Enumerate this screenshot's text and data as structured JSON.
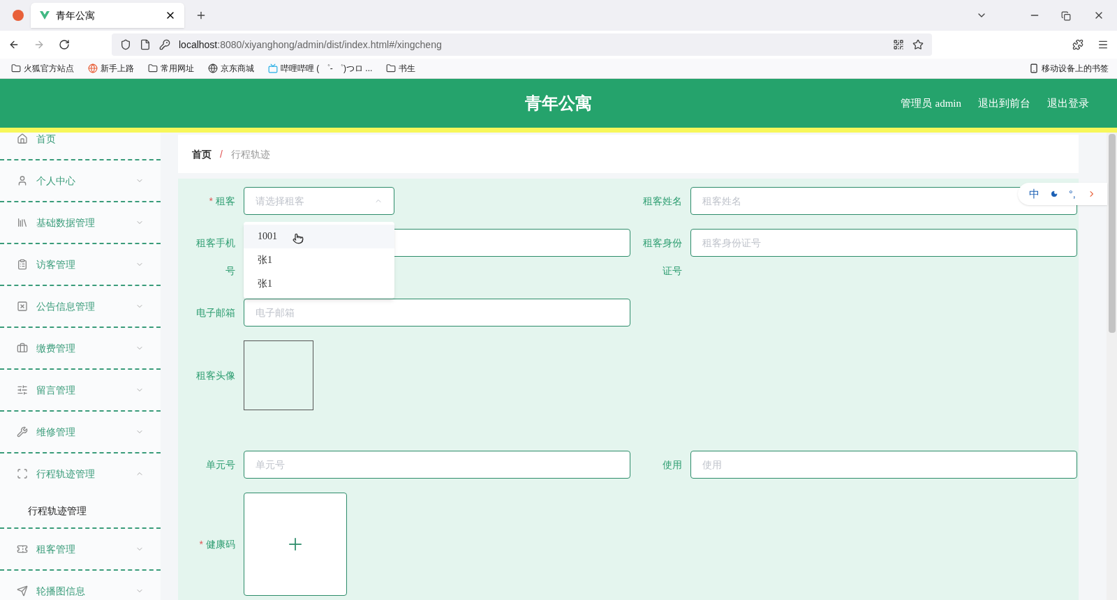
{
  "browser": {
    "tabs": [
      {
        "title": "青年公寓",
        "selected": true
      }
    ],
    "url_host": "localhost",
    "url_rest": ":8080/xiyanghong/admin/dist/index.html#/xingcheng",
    "bookmarks": [
      {
        "label": "火狐官方站点",
        "kind": "folder"
      },
      {
        "label": "新手上路",
        "kind": "firefox"
      },
      {
        "label": "常用网址",
        "kind": "folder"
      },
      {
        "label": "京东商城",
        "kind": "globe"
      },
      {
        "label": "哔哩哔哩 ( ゜- ゜)つロ ...",
        "kind": "tv"
      },
      {
        "label": "书生",
        "kind": "folder"
      }
    ],
    "mobile_bookmarks": "移动设备上的书签"
  },
  "header": {
    "title": "青年公寓",
    "role": "管理员",
    "user": "admin",
    "links": [
      "退出到前台",
      "退出登录"
    ]
  },
  "sidebar": {
    "items": [
      {
        "label": "首页",
        "kind": "home"
      },
      {
        "label": "个人中心",
        "kind": "user",
        "expanded": false
      },
      {
        "label": "基础数据管理",
        "kind": "books",
        "expanded": false
      },
      {
        "label": "访客管理",
        "kind": "clipboard",
        "expanded": false
      },
      {
        "label": "公告信息管理",
        "kind": "notice",
        "expanded": false
      },
      {
        "label": "缴费管理",
        "kind": "briefcase",
        "expanded": false
      },
      {
        "label": "留言管理",
        "kind": "sliders",
        "expanded": false
      },
      {
        "label": "维修管理",
        "kind": "tool",
        "expanded": false
      },
      {
        "label": "行程轨迹管理",
        "kind": "frame",
        "expanded": true,
        "children": [
          {
            "label": "行程轨迹管理"
          }
        ]
      },
      {
        "label": "租客管理",
        "kind": "ticket",
        "expanded": false
      },
      {
        "label": "轮播图信息",
        "kind": "send",
        "expanded": false
      }
    ]
  },
  "breadcrumb": {
    "items": [
      "首页",
      "行程轨迹"
    ],
    "separator": "/"
  },
  "form": {
    "required_mark": "*",
    "rows": [
      [
        {
          "kind": "select",
          "label": "租客",
          "required": true,
          "placeholder": "请选择租客",
          "open": true
        },
        {
          "kind": "input",
          "label": "租客姓名",
          "required": false,
          "placeholder": "租客姓名"
        }
      ],
      [
        {
          "kind": "input",
          "label": "租客手机号",
          "required": false
        },
        {
          "kind": "input",
          "label": "租客身份证号",
          "required": false,
          "placeholder": "租客身份证号"
        }
      ],
      [
        {
          "kind": "input",
          "label": "电子邮箱",
          "required": false,
          "placeholder": "电子邮箱"
        }
      ],
      [
        {
          "kind": "image",
          "label": "租客头像",
          "required": false
        }
      ],
      [
        {
          "kind": "input",
          "label": "单元号",
          "required": false,
          "placeholder": "单元号"
        },
        {
          "kind": "input",
          "label": "使用",
          "required": false,
          "placeholder": "使用"
        }
      ],
      [
        {
          "kind": "upload",
          "label": "健康码",
          "required": true
        }
      ]
    ],
    "dropdown": [
      {
        "label": "1001",
        "highlighted": true
      },
      {
        "label": "张1",
        "highlighted": false
      },
      {
        "label": "张1",
        "highlighted": false
      }
    ]
  },
  "ime": {
    "mode": "中",
    "punctuation": "°,"
  }
}
